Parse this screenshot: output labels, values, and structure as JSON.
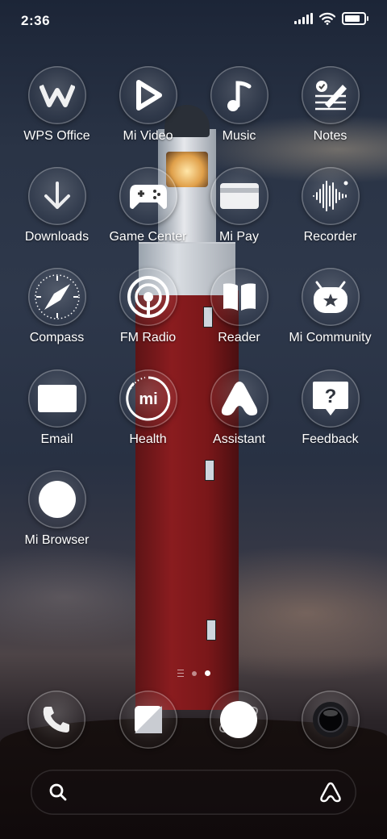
{
  "status_bar": {
    "time": "2:36",
    "icons": [
      "cellular-signal-icon",
      "wifi-icon",
      "battery-icon"
    ]
  },
  "apps": [
    {
      "label": "WPS Office",
      "icon": "wps-office-icon"
    },
    {
      "label": "Mi Video",
      "icon": "play-icon"
    },
    {
      "label": "Music",
      "icon": "music-note-icon"
    },
    {
      "label": "Notes",
      "icon": "notes-pen-icon"
    },
    {
      "label": "Downloads",
      "icon": "download-arrow-icon"
    },
    {
      "label": "Game Center",
      "icon": "gamepad-icon"
    },
    {
      "label": "Mi Pay",
      "icon": "card-icon"
    },
    {
      "label": "Recorder",
      "icon": "waveform-icon"
    },
    {
      "label": "Compass",
      "icon": "compass-icon"
    },
    {
      "label": "FM Radio",
      "icon": "radio-broadcast-icon"
    },
    {
      "label": "Reader",
      "icon": "book-icon"
    },
    {
      "label": "Mi Community",
      "icon": "mi-mascot-icon"
    },
    {
      "label": "Email",
      "icon": "envelope-icon"
    },
    {
      "label": "Health",
      "icon": "mi-health-icon"
    },
    {
      "label": "Assistant",
      "icon": "assistant-a-icon"
    },
    {
      "label": "Feedback",
      "icon": "question-bubble-icon"
    },
    {
      "label": "Mi Browser",
      "icon": "browser-globe-icon"
    }
  ],
  "page_indicator": {
    "pages": 2,
    "active": 2
  },
  "dock": [
    {
      "name": "phone",
      "icon": "phone-icon"
    },
    {
      "name": "messaging",
      "icon": "messaging-square-icon"
    },
    {
      "name": "browser",
      "icon": "browser-orbit-icon"
    },
    {
      "name": "camera",
      "icon": "camera-lens-icon"
    }
  ],
  "search_bar": {
    "left_icon": "search-icon",
    "right_icon": "assistant-a-icon"
  },
  "colors": {
    "text": "#ffffff",
    "tower_red": "#8a1c1f",
    "sky": "#2a3446"
  }
}
